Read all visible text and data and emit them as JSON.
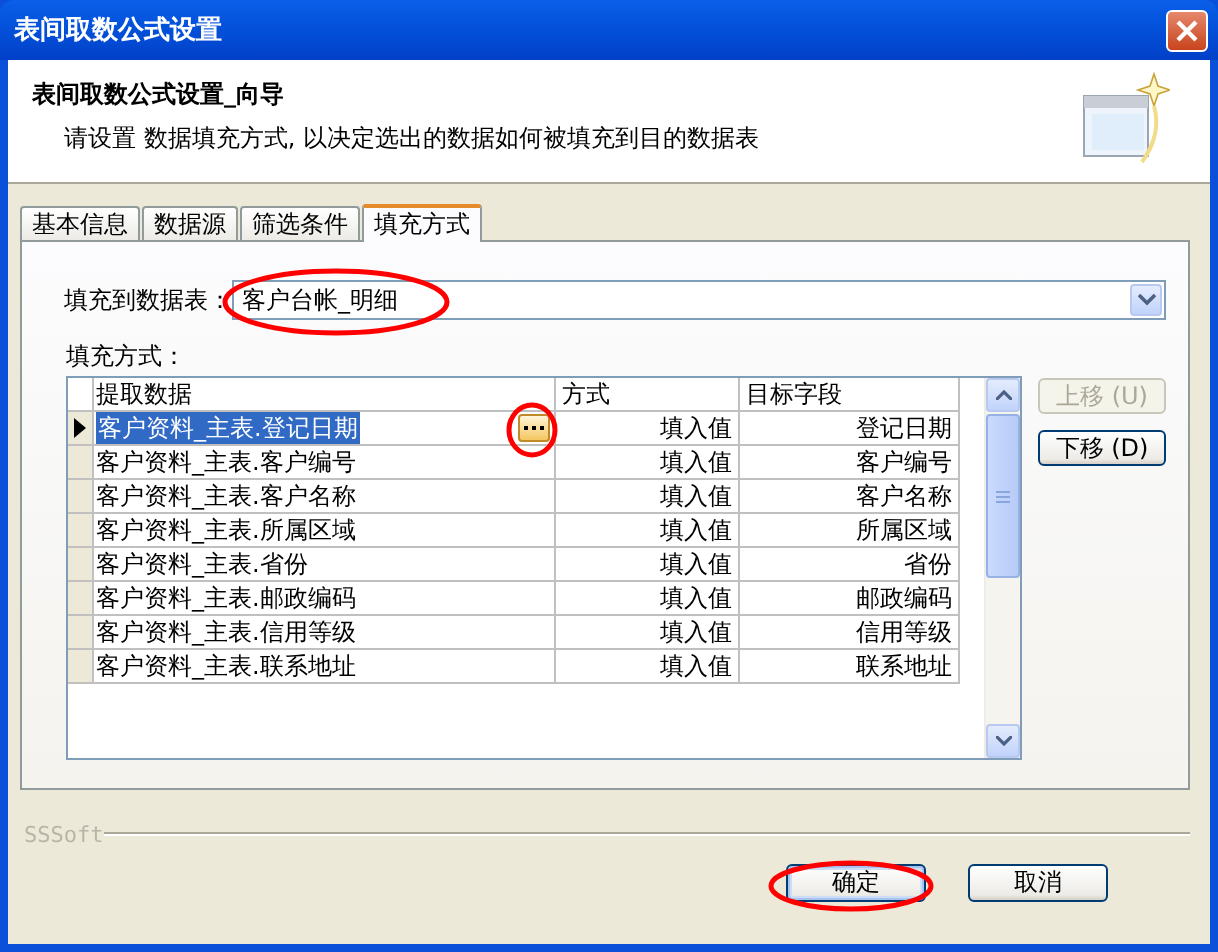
{
  "window": {
    "title": "表间取数公式设置"
  },
  "header": {
    "title": "表间取数公式设置_向导",
    "description": "请设置 数据填充方式, 以决定选出的数据如何被填充到目的数据表"
  },
  "tabs": [
    {
      "label": "基本信息",
      "selected": false
    },
    {
      "label": "数据源",
      "selected": false
    },
    {
      "label": "筛选条件",
      "selected": false
    },
    {
      "label": "填充方式",
      "selected": true
    }
  ],
  "target_table": {
    "label": "填充到数据表：",
    "value": "客户台帐_明细"
  },
  "fill_mode": {
    "label": "填充方式：",
    "columns": [
      "提取数据",
      "方式",
      "目标字段"
    ],
    "rows": [
      {
        "source": "客户资料_主表.登记日期",
        "method": "填入值",
        "target": "登记日期",
        "selected": true
      },
      {
        "source": "客户资料_主表.客户编号",
        "method": "填入值",
        "target": "客户编号",
        "selected": false
      },
      {
        "source": "客户资料_主表.客户名称",
        "method": "填入值",
        "target": "客户名称",
        "selected": false
      },
      {
        "source": "客户资料_主表.所属区域",
        "method": "填入值",
        "target": "所属区域",
        "selected": false
      },
      {
        "source": "客户资料_主表.省份",
        "method": "填入值",
        "target": "省份",
        "selected": false
      },
      {
        "source": "客户资料_主表.邮政编码",
        "method": "填入值",
        "target": "邮政编码",
        "selected": false
      },
      {
        "source": "客户资料_主表.信用等级",
        "method": "填入值",
        "target": "信用等级",
        "selected": false
      },
      {
        "source": "客户资料_主表.联系地址",
        "method": "填入值",
        "target": "联系地址",
        "selected": false
      }
    ]
  },
  "side_buttons": [
    {
      "label": "上移 (U)",
      "disabled": true
    },
    {
      "label": "下移 (D)",
      "disabled": false
    }
  ],
  "footer": {
    "brand": "SSSoft"
  },
  "buttons": [
    {
      "label": "确定",
      "default": true
    },
    {
      "label": "取消",
      "default": false
    }
  ]
}
